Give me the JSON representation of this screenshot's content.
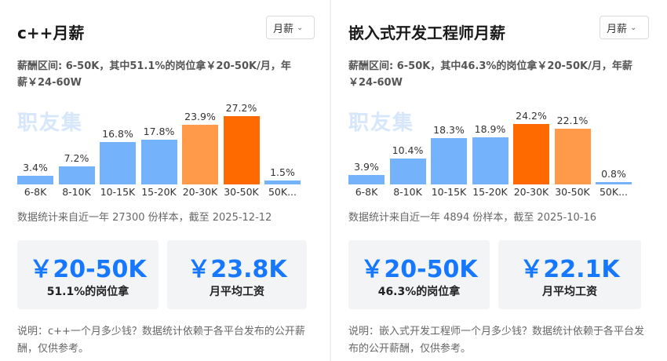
{
  "colors": {
    "light_blue": "#74b3fb",
    "light_orange": "#ff9a4a",
    "dark_orange": "#ff6a00",
    "accent_blue": "#1677ff"
  },
  "cards": [
    {
      "title": "c++月薪",
      "dropdown_label": "月薪",
      "summary": "薪酬区间: 6-50K，其中51.1%的岗位拿￥20-50K/月，年薪￥24-60W",
      "watermark": "职友集",
      "source": "数据统计来自近一年 27300 份样本，截至 2025-12-12",
      "stats": [
        {
          "value": "￥20-50K",
          "caption": "51.1%的岗位拿"
        },
        {
          "value": "￥23.8K",
          "caption": "月平均工资"
        }
      ],
      "note": "说明：c++一个月多少钱？数据统计依赖于各平台发布的公开薪酬，仅供参考。",
      "chart_data": {
        "type": "bar",
        "categories": [
          "6-8K",
          "8-10K",
          "10-15K",
          "15-20K",
          "20-30K",
          "30-50K",
          "50K..."
        ],
        "values": [
          3.4,
          7.2,
          16.8,
          17.8,
          23.9,
          27.2,
          1.5
        ],
        "labels": [
          "3.4%",
          "7.2%",
          "16.8%",
          "17.8%",
          "23.9%",
          "27.2%",
          "1.5%"
        ],
        "colors": [
          "#74b3fb",
          "#74b3fb",
          "#74b3fb",
          "#74b3fb",
          "#ff9a4a",
          "#ff6a00",
          "#74b3fb"
        ],
        "ylabel": "",
        "xlabel": ""
      }
    },
    {
      "title": "嵌入式开发工程师月薪",
      "dropdown_label": "月薪",
      "summary": "薪酬区间: 6-50K，其中46.3%的岗位拿￥20-50K/月，年薪￥24-60W",
      "watermark": "职友集",
      "source": "数据统计来自近一年 4894 份样本，截至 2025-10-16",
      "stats": [
        {
          "value": "￥20-50K",
          "caption": "46.3%的岗位拿"
        },
        {
          "value": "￥22.1K",
          "caption": "月平均工资"
        }
      ],
      "note": "说明：嵌入式开发工程师一个月多少钱？数据统计依赖于各平台发布的公开薪酬，仅供参考。",
      "chart_data": {
        "type": "bar",
        "categories": [
          "6-8K",
          "8-10K",
          "10-15K",
          "15-20K",
          "20-30K",
          "30-50K",
          "50K..."
        ],
        "values": [
          3.9,
          10.4,
          18.3,
          18.9,
          24.2,
          22.1,
          0.8
        ],
        "labels": [
          "3.9%",
          "10.4%",
          "18.3%",
          "18.9%",
          "24.2%",
          "22.1%",
          "0.8%"
        ],
        "colors": [
          "#74b3fb",
          "#74b3fb",
          "#74b3fb",
          "#74b3fb",
          "#ff6a00",
          "#ff9a4a",
          "#74b3fb"
        ],
        "ylabel": "",
        "xlabel": ""
      }
    }
  ]
}
